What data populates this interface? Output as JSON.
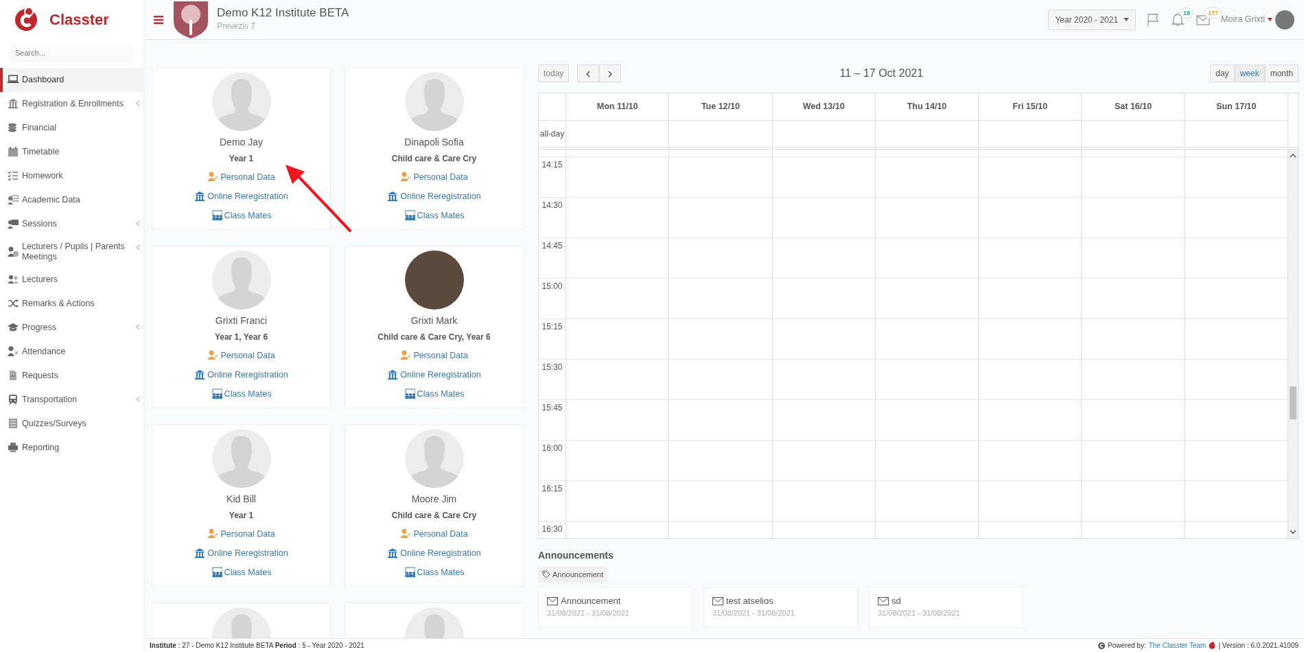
{
  "sidebar": {
    "brand": "Classter",
    "search": {
      "placeholder": "Search..."
    },
    "items": [
      {
        "label": "Dashboard",
        "selected": true,
        "expandable": false
      },
      {
        "label": "Registration & Enrollments",
        "selected": false,
        "expandable": true
      },
      {
        "label": "Financial",
        "selected": false,
        "expandable": false
      },
      {
        "label": "Timetable",
        "selected": false,
        "expandable": false
      },
      {
        "label": "Homework",
        "selected": false,
        "expandable": false
      },
      {
        "label": "Academic Data",
        "selected": false,
        "expandable": false
      },
      {
        "label": "Sessions",
        "selected": false,
        "expandable": true
      },
      {
        "label": "Lecturers / Pupils | Parents Meetings",
        "selected": false,
        "expandable": true
      },
      {
        "label": "Lecturers",
        "selected": false,
        "expandable": false
      },
      {
        "label": "Remarks & Actions",
        "selected": false,
        "expandable": false
      },
      {
        "label": "Progress",
        "selected": false,
        "expandable": true
      },
      {
        "label": "Attendance",
        "selected": false,
        "expandable": false
      },
      {
        "label": "Requests",
        "selected": false,
        "expandable": false
      },
      {
        "label": "Transportation",
        "selected": false,
        "expandable": true
      },
      {
        "label": "Quizzes/Surveys",
        "selected": false,
        "expandable": false
      },
      {
        "label": "Reporting",
        "selected": false,
        "expandable": false
      }
    ]
  },
  "header": {
    "title": "Demo K12 Institute BETA",
    "subtitle": "Prevezis 7",
    "year_selector": "Year 2020 - 2021",
    "notifications": [
      {
        "kind": "flag"
      },
      {
        "kind": "bell",
        "count": "18",
        "color": "#1bb394"
      },
      {
        "kind": "mail",
        "count": "177",
        "color": "#f39c3c"
      }
    ],
    "user": "Moira Grixti"
  },
  "students": [
    {
      "kind": "silhouette",
      "name": "Demo Jay",
      "class": "Year 1",
      "links": [
        {
          "kind": "personal",
          "label": "Personal Data"
        },
        {
          "kind": "registration",
          "label": "Online Reregistration"
        },
        {
          "kind": "classmates",
          "label": "Class Mates"
        }
      ]
    },
    {
      "kind": "silhouette",
      "name": "Dinapoli Sofia",
      "class": "Child care & Care Cry",
      "links": [
        {
          "kind": "personal",
          "label": "Personal Data"
        },
        {
          "kind": "registration",
          "label": "Online Reregistration"
        },
        {
          "kind": "classmates",
          "label": "Class Mates"
        }
      ]
    },
    {
      "kind": "silhouette",
      "name": "Grixti Franci",
      "class": "Year 1, Year 6",
      "links": [
        {
          "kind": "personal",
          "label": "Personal Data"
        },
        {
          "kind": "registration",
          "label": "Online Reregistration"
        },
        {
          "kind": "classmates",
          "label": "Class Mates"
        }
      ]
    },
    {
      "kind": "photo",
      "name": "Grixti Mark",
      "class": "Child care & Care Cry, Year 6",
      "links": [
        {
          "kind": "personal",
          "label": "Personal Data"
        },
        {
          "kind": "registration",
          "label": "Online Reregistration"
        },
        {
          "kind": "classmates",
          "label": "Class Mates"
        }
      ]
    },
    {
      "kind": "silhouette",
      "name": "Kid Bill",
      "class": "Year 1",
      "links": [
        {
          "kind": "personal",
          "label": "Personal Data"
        },
        {
          "kind": "registration",
          "label": "Online Reregistration"
        },
        {
          "kind": "classmates",
          "label": "Class Mates"
        }
      ]
    },
    {
      "kind": "silhouette",
      "name": "Moore Jim",
      "class": "Child care & Care Cry",
      "links": [
        {
          "kind": "personal",
          "label": "Personal Data"
        },
        {
          "kind": "registration",
          "label": "Online Reregistration"
        },
        {
          "kind": "classmates",
          "label": "Class Mates"
        }
      ]
    },
    {
      "kind": "silhouette"
    },
    {
      "kind": "silhouette"
    }
  ],
  "calendar": {
    "today_button": "today",
    "title": "11 – 17 Oct 2021",
    "views": [
      {
        "label": "day",
        "selected": false
      },
      {
        "label": "week",
        "selected": true
      },
      {
        "label": "month",
        "selected": false
      }
    ],
    "days": [
      "Mon 11/10",
      "Tue 12/10",
      "Wed 13/10",
      "Thu 14/10",
      "Fri 15/10",
      "Sat 16/10",
      "Sun 17/10"
    ],
    "all_day_label": "all-day",
    "times": [
      "14:15",
      "14:30",
      "14:45",
      "15:00",
      "15:15",
      "15:30",
      "15:45",
      "16:00",
      "16:15",
      "16:30"
    ]
  },
  "announcements": {
    "heading": "Announcements",
    "filter": "Announcement",
    "items": [
      {
        "title": "Announcement",
        "dates": "31/08/2021 - 31/08/2021"
      },
      {
        "title": "test atselios",
        "dates": "31/08/2021 - 31/08/2021"
      },
      {
        "title": "sd",
        "dates": "31/08/2021 - 31/08/2021"
      }
    ]
  },
  "footer": {
    "info": "**Institute** : 27 - Demo K12 Institute BETA **Period** : 5 - Year 2020 - 2021",
    "powered_by": "Powered by:",
    "team_link": "The Classter Team",
    "version": "| Version : 6.0.2021.41009"
  }
}
